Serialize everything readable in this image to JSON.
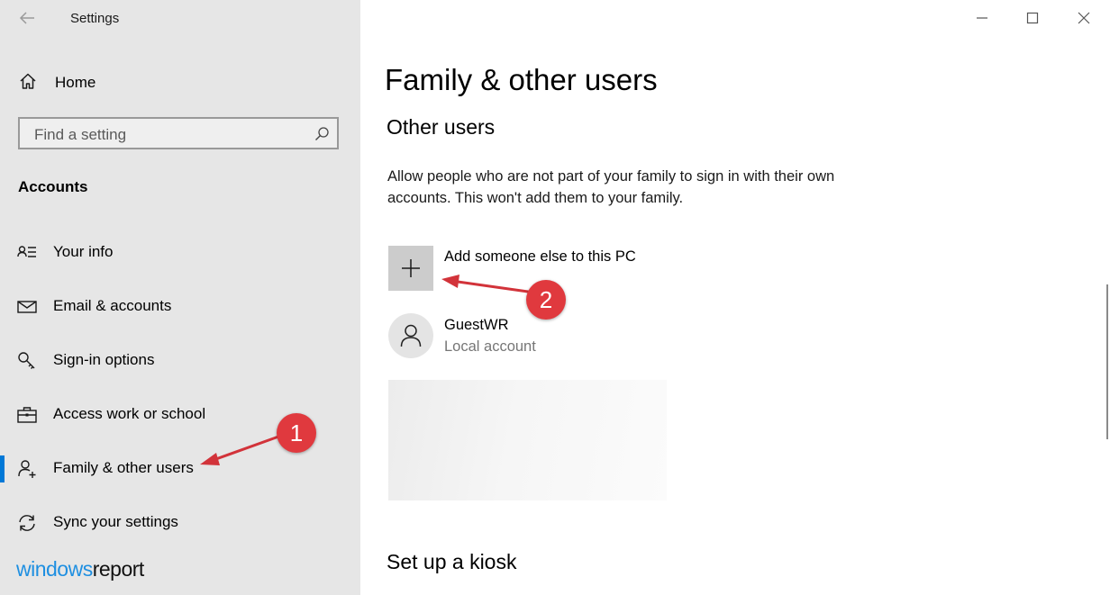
{
  "window": {
    "title": "Settings",
    "controls": {
      "minimize": "minimize-icon",
      "maximize": "maximize-icon",
      "close": "close-icon"
    }
  },
  "sidebar": {
    "home_label": "Home",
    "search_placeholder": "Find a setting",
    "section_title": "Accounts",
    "items": [
      {
        "label": "Your info",
        "icon": "person-list-icon",
        "active": false
      },
      {
        "label": "Email & accounts",
        "icon": "mail-icon",
        "active": false
      },
      {
        "label": "Sign-in options",
        "icon": "key-icon",
        "active": false
      },
      {
        "label": "Access work or school",
        "icon": "briefcase-icon",
        "active": false
      },
      {
        "label": "Family & other users",
        "icon": "person-add-icon",
        "active": true
      },
      {
        "label": "Sync your settings",
        "icon": "sync-icon",
        "active": false
      }
    ],
    "brand_windows": "windows",
    "brand_report": "report"
  },
  "main": {
    "title": "Family & other users",
    "subtitle": "Other users",
    "description": "Allow people who are not part of your family to sign in with their own accounts. This won't add them to your family.",
    "add_label": "Add someone else to this PC",
    "user": {
      "name": "GuestWR",
      "type": "Local account"
    },
    "kiosk_title": "Set up a kiosk"
  },
  "annotations": [
    {
      "number": "1",
      "color": "#e0393e"
    },
    {
      "number": "2",
      "color": "#e0393e"
    }
  ],
  "colors": {
    "accent": "#0078d7",
    "sidebar_bg": "#e6e6e6",
    "annotation": "#e0393e"
  }
}
